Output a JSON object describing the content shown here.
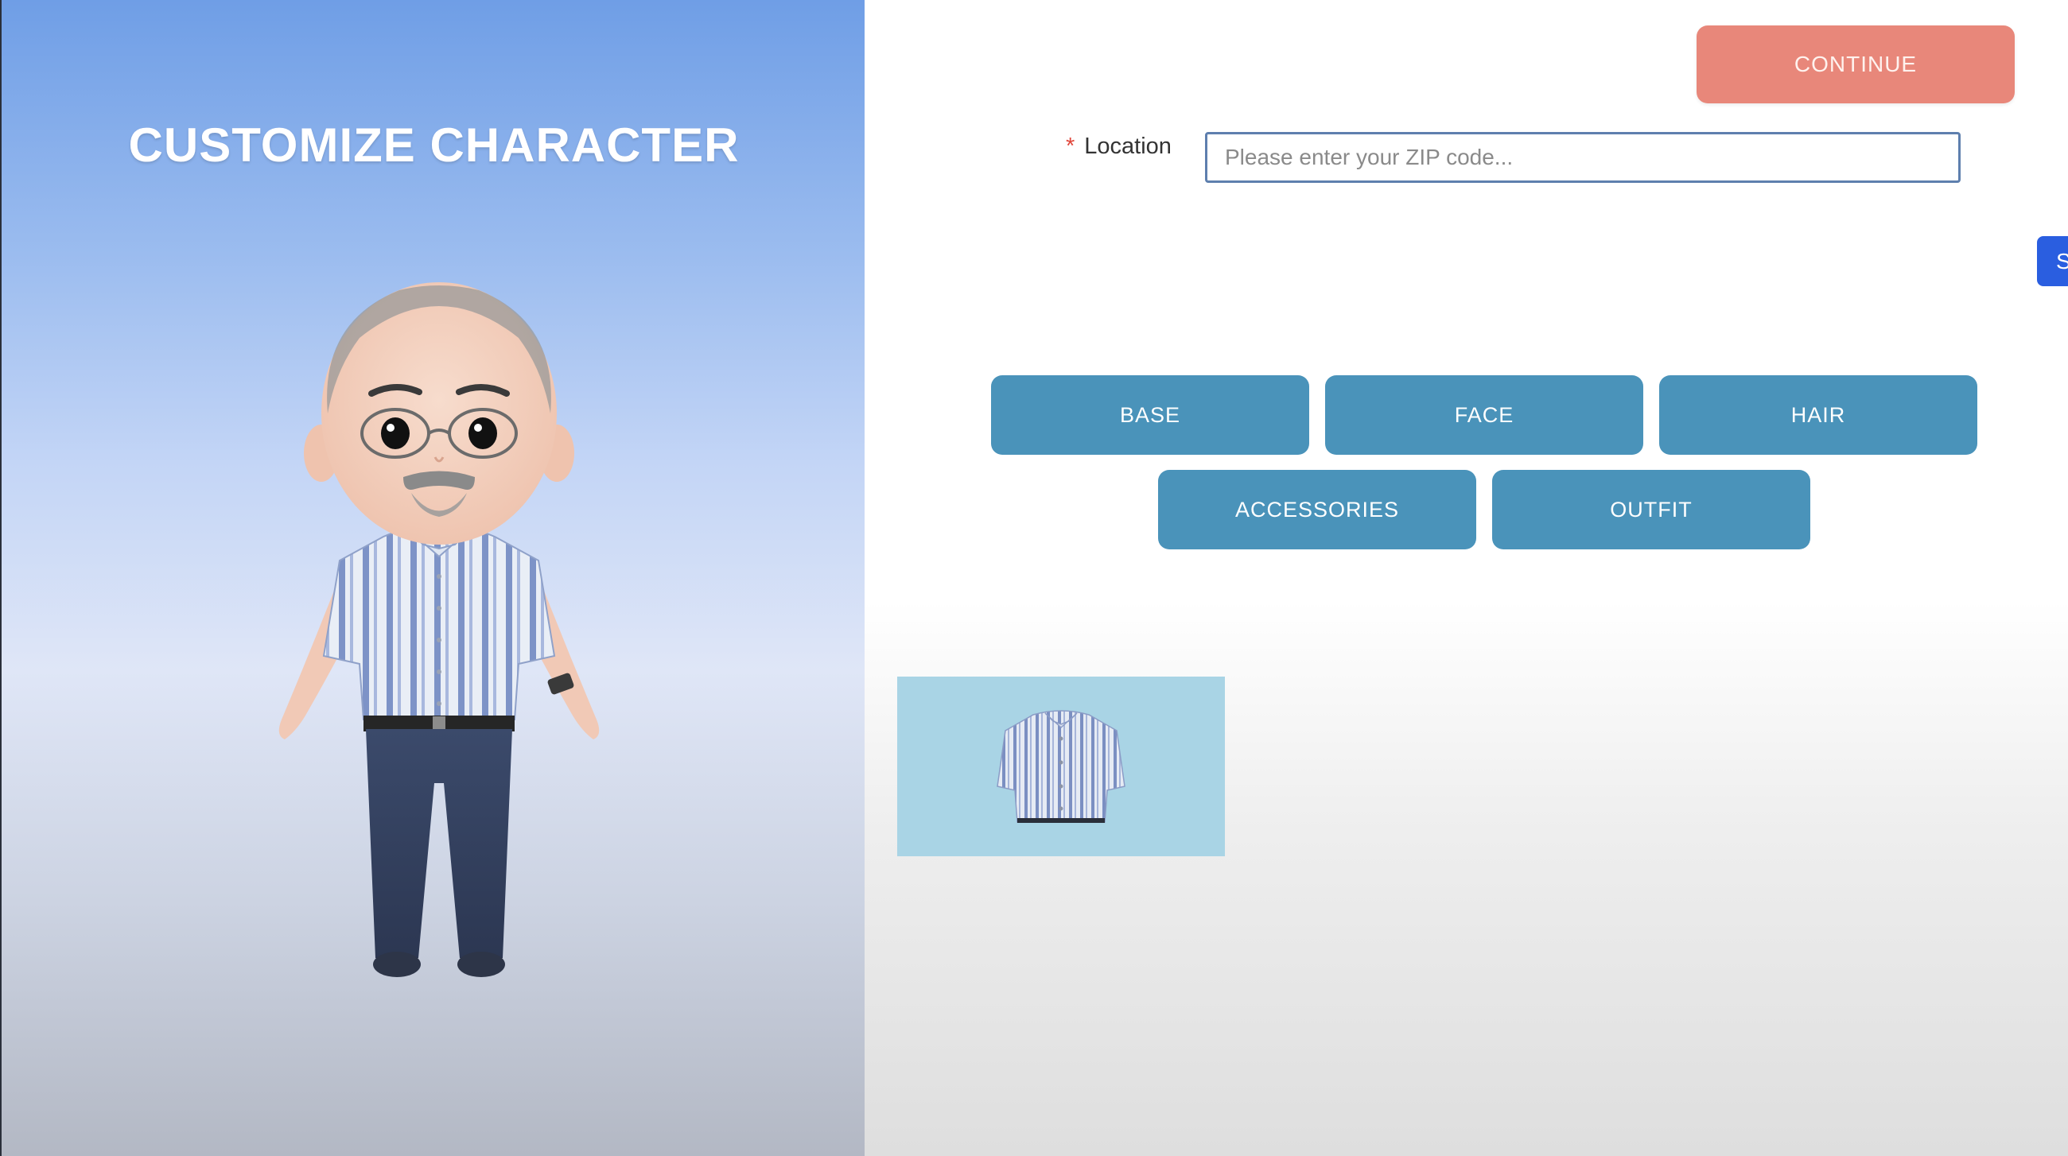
{
  "preview": {
    "title": "CUSTOMIZE CHARACTER"
  },
  "header": {
    "continue_label": "CONTINUE",
    "edge_tab_label": "S"
  },
  "location": {
    "required_mark": "*",
    "label": "Location",
    "placeholder": "Please enter your ZIP code...",
    "value": ""
  },
  "categories": [
    {
      "label": "BASE"
    },
    {
      "label": "FACE"
    },
    {
      "label": "HAIR"
    },
    {
      "label": "ACCESSORIES"
    },
    {
      "label": "OUTFIT"
    }
  ],
  "items": [
    {
      "icon": "striped-shirt-icon"
    }
  ],
  "colors": {
    "accent_continue": "#e8877a",
    "category_button": "#4a93ba",
    "tab_blue": "#2a5ee0",
    "item_tile_bg": "#a9d4e5"
  }
}
